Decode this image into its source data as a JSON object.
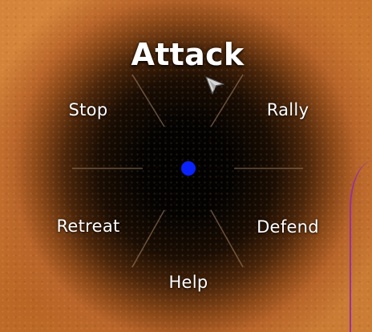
{
  "radial_menu": {
    "selected": "Attack",
    "options": {
      "top": "Attack",
      "upper_left": "Stop",
      "upper_right": "Rally",
      "lower_left": "Retreat",
      "lower_right": "Defend",
      "bottom": "Help"
    }
  },
  "icons": {
    "center": "center-dot-icon",
    "pointer": "mouse-pointer-icon"
  },
  "colors": {
    "center_dot": "#0a22ff",
    "label_text": "#ffffff",
    "divider": "#b08a6a",
    "ground": "#c8702a"
  }
}
